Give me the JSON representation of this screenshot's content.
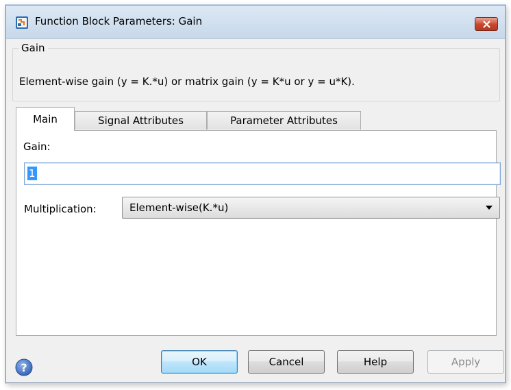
{
  "window": {
    "title": "Function Block Parameters: Gain"
  },
  "group": {
    "legend": "Gain",
    "description": "Element-wise gain (y = K.*u) or matrix gain (y = K*u or y = u*K)."
  },
  "tabs": [
    {
      "label": "Main",
      "active": true
    },
    {
      "label": "Signal Attributes",
      "active": false
    },
    {
      "label": "Parameter Attributes",
      "active": false
    }
  ],
  "main": {
    "gain_label": "Gain:",
    "gain_value": "1",
    "multiplication_label": "Multiplication:",
    "multiplication_value": "Element-wise(K.*u)"
  },
  "buttons": {
    "ok": "OK",
    "cancel": "Cancel",
    "help": "Help",
    "apply": "Apply"
  },
  "icons": {
    "app": "simulink-block-icon",
    "close": "close-icon",
    "dropdown": "chevron-down-icon",
    "help": "help-icon"
  },
  "colors": {
    "close_button": "#c8452c",
    "selection": "#3399ff",
    "ok_button": "#bee6fd",
    "titlebar": "#dce8f5"
  }
}
